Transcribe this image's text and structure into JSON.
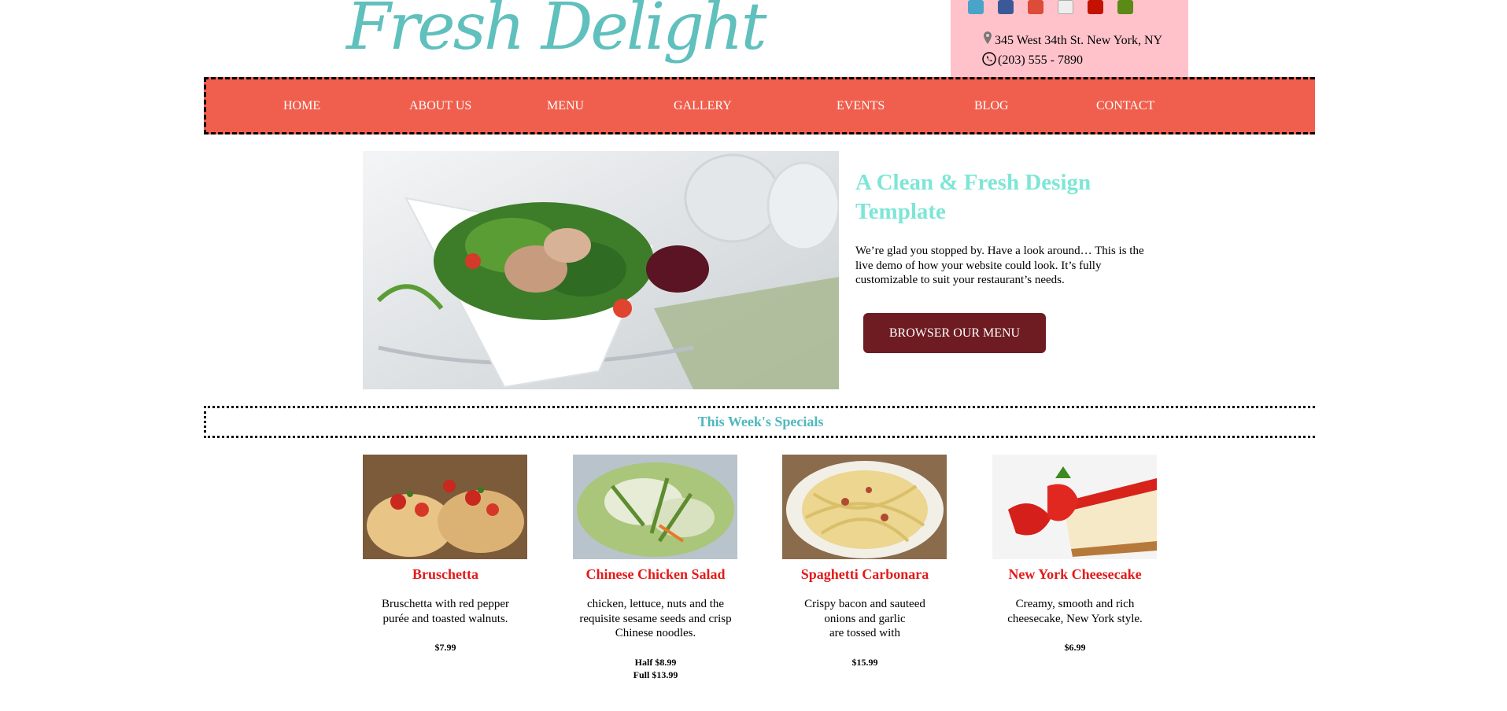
{
  "header": {
    "logo": "Fresh Delight",
    "address": "345 West 34th St. New York, NY",
    "phone": "(203) 555 - 7890",
    "social_icons": [
      {
        "name": "twitter-icon",
        "color": "#4aa3c9"
      },
      {
        "name": "facebook-icon",
        "color": "#3b5998"
      },
      {
        "name": "google-plus-icon",
        "color": "#dd4b39"
      },
      {
        "name": "broken-image-icon",
        "color": "#d8d8d8"
      },
      {
        "name": "yelp-icon",
        "color": "#c41200"
      },
      {
        "name": "tripadvisor-icon",
        "color": "#5b8a17"
      }
    ]
  },
  "nav": {
    "items": [
      "HOME",
      "ABOUT US",
      "MENU",
      "GALLERY",
      "EVENTS",
      "BLOG",
      "CONTACT"
    ]
  },
  "hero": {
    "title": "A Clean & Fresh Design Template",
    "text": "We’re glad you stopped by. Have a look around… This is the live demo of how your website could look. It’s fully customizable to suit your restaurant’s needs.",
    "button": "BROWSER OUR MENU"
  },
  "specials": {
    "title": "This Week's Specials",
    "items": [
      {
        "name": "Bruschetta",
        "desc": "Bruschetta with red pepper\npurée and toasted walnuts.",
        "price": "$7.99"
      },
      {
        "name": "Chinese Chicken Salad",
        "desc": "chicken, lettuce, nuts and the\nrequisite sesame seeds and crisp\nChinese noodles.",
        "price": "Half $8.99\nFull $13.99"
      },
      {
        "name": "Spaghetti Carbonara",
        "desc": "Crispy bacon and sauteed\nonions and garlic\nare tossed with",
        "price": "$15.99"
      },
      {
        "name": "New York Cheesecake",
        "desc": "Creamy, smooth and rich\ncheesecake, New York style.",
        "price": "$6.99"
      }
    ]
  },
  "colors": {
    "nav_bg": "#f05f4d",
    "accent_teal": "#5fc0bd",
    "hero_title": "#7de6d6",
    "button_bg": "#6e1c22",
    "dish_name": "#e31a1a",
    "contact_bg": "#ffc2cb"
  }
}
